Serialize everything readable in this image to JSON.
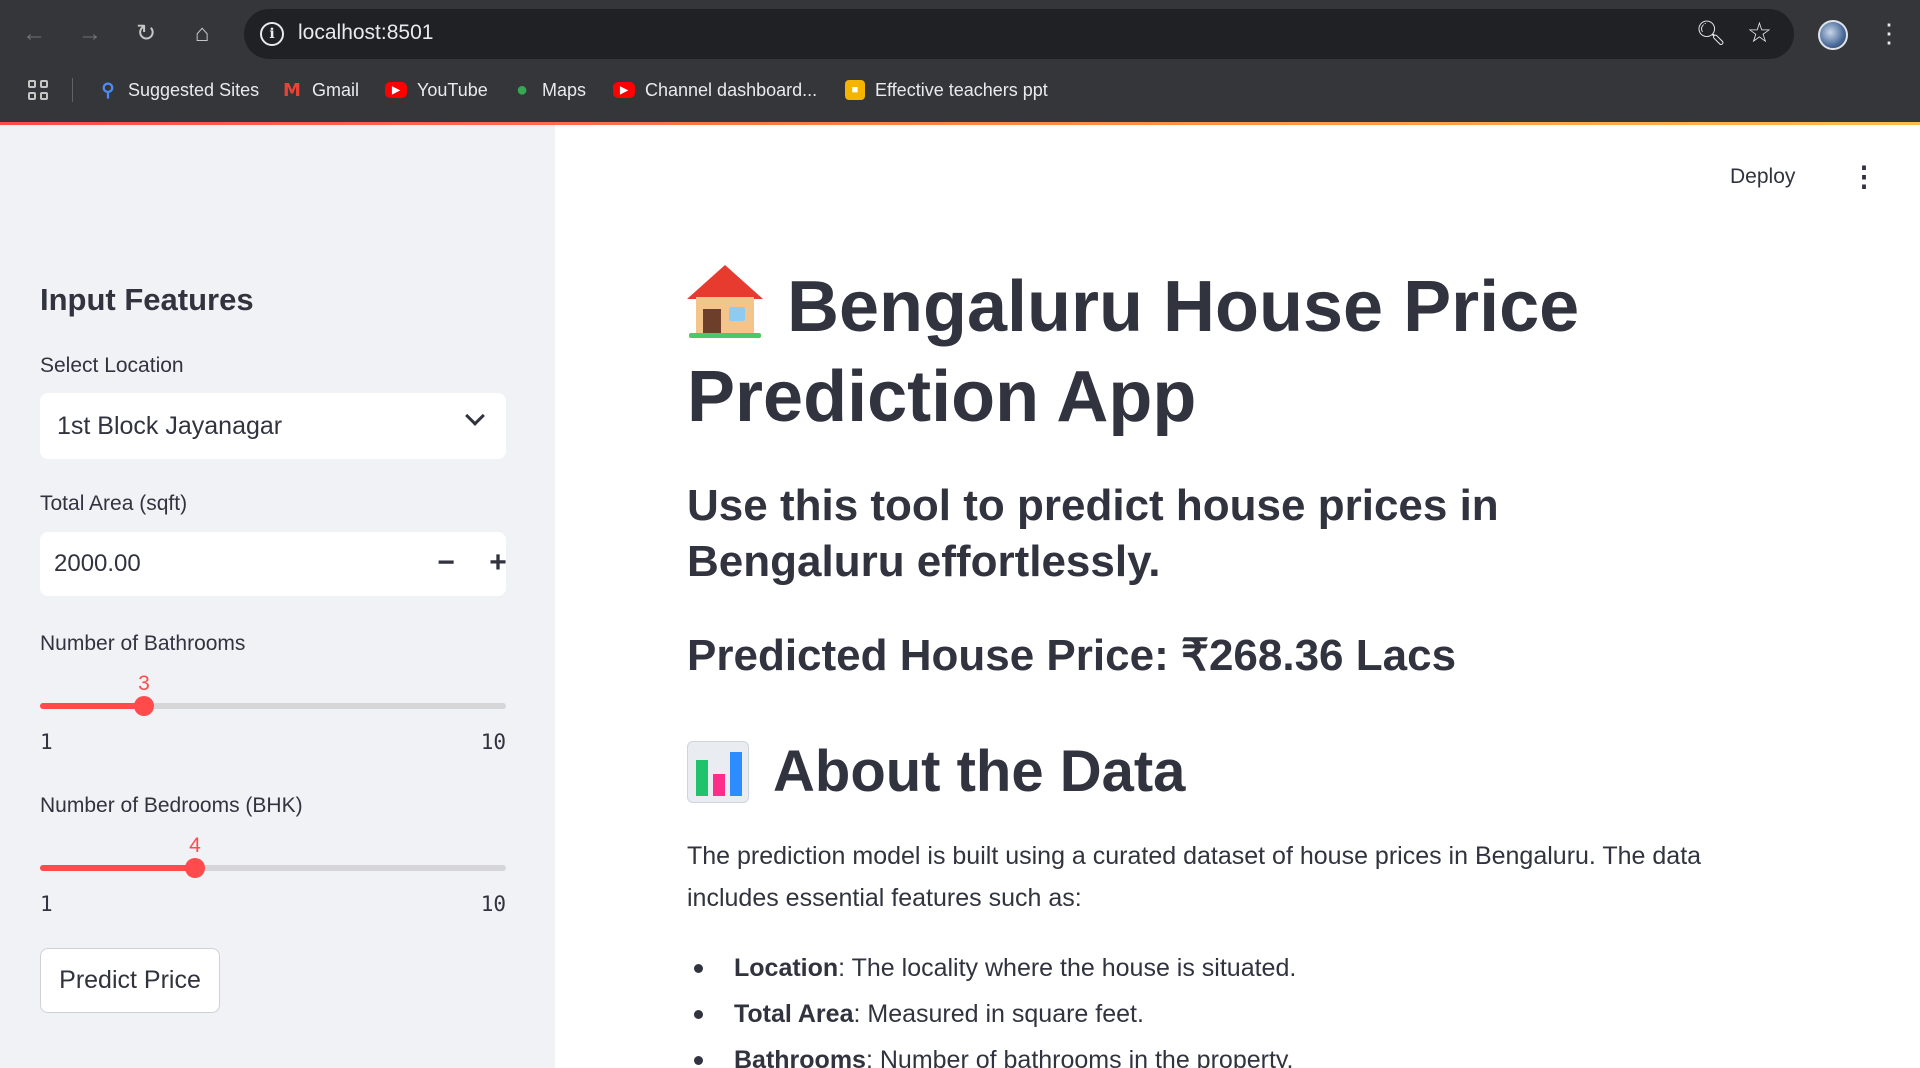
{
  "browser": {
    "url": "localhost:8501",
    "bookmarks": [
      {
        "label": "Suggested Sites",
        "icon": "search-icon"
      },
      {
        "label": "Gmail",
        "icon": "gmail-icon"
      },
      {
        "label": "YouTube",
        "icon": "youtube-icon"
      },
      {
        "label": "Maps",
        "icon": "maps-icon"
      },
      {
        "label": "Channel dashboard...",
        "icon": "youtube-icon"
      },
      {
        "label": "Effective teachers ppt",
        "icon": "slides-icon"
      }
    ]
  },
  "app": {
    "deploy_label": "Deploy",
    "accent_color": "#ff4b4b"
  },
  "sidebar": {
    "title": "Input Features",
    "location": {
      "label": "Select Location",
      "value": "1st Block Jayanagar"
    },
    "area": {
      "label": "Total Area (sqft)",
      "value": "2000.00",
      "minus": "−",
      "plus": "+"
    },
    "bathrooms": {
      "label": "Number of Bathrooms",
      "value": "3",
      "value_num": 3,
      "min": "1",
      "max": "10",
      "min_num": 1,
      "max_num": 10
    },
    "bedrooms": {
      "label": "Number of Bedrooms (BHK)",
      "value": "4",
      "value_num": 4,
      "min": "1",
      "max": "10",
      "min_num": 1,
      "max_num": 10
    },
    "predict_button": "Predict Price"
  },
  "main": {
    "title": "Bengaluru House Price Prediction App",
    "subtitle": "Use this tool to predict house prices in Bengaluru effortlessly.",
    "prediction": "Predicted House Price: ₹268.36 Lacs",
    "about_heading": "About the Data",
    "about_text": "The prediction model is built using a curated dataset of house prices in Bengaluru. The data includes essential features such as:",
    "features": [
      {
        "name": "Location",
        "desc": ": The locality where the house is situated."
      },
      {
        "name": "Total Area",
        "desc": ": Measured in square feet."
      },
      {
        "name": "Bathrooms",
        "desc": ": Number of bathrooms in the property."
      }
    ]
  }
}
